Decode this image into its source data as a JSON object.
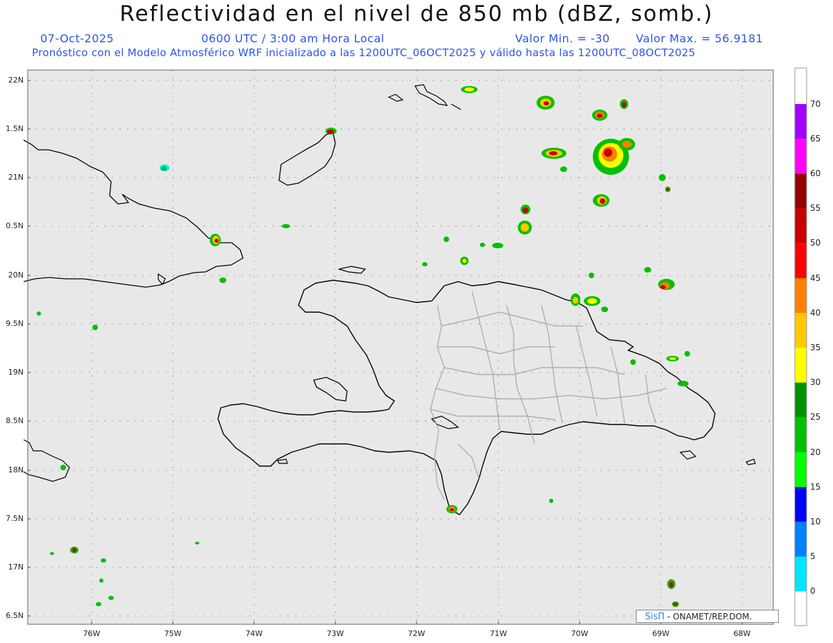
{
  "header": {
    "title": "Reflectividad en el nivel de 850 mb (dBZ, somb.)",
    "date": "07-Oct-2025",
    "time": "0600 UTC / 3:00 am Hora Local",
    "min_label": "Valor Min. = -30",
    "max_label": "Valor Max. = 56.9181",
    "forecast": "Pronóstico con el Modelo Atmosférico WRF inicializado a las 1200UTC_06OCT2025 y válido hasta las  1200UTC_08OCT2025"
  },
  "lat_labels": [
    "22N",
    "1.5N",
    "21N",
    "0.5N",
    "20N",
    "9.5N",
    "19N",
    "8.5N",
    "18N",
    "7.5N",
    "17N",
    "6.5N"
  ],
  "lon_labels": [
    "76W",
    "75W",
    "74W",
    "73W",
    "72W",
    "71W",
    "70W",
    "69W",
    "68W"
  ],
  "colorbar": {
    "labels": [
      "70",
      "65",
      "60",
      "55",
      "50",
      "45",
      "40",
      "35",
      "30",
      "25",
      "20",
      "15",
      "10",
      "5",
      "0"
    ],
    "colors": [
      "#a100ff",
      "#ff00ff",
      "#960000",
      "#c80000",
      "#ff0000",
      "#ff8000",
      "#ffc800",
      "#ffff00",
      "#009000",
      "#00c000",
      "#00ff00",
      "#0000ff",
      "#0080ff",
      "#00e6ff",
      "#ffffff"
    ]
  },
  "credit": {
    "logo": "SisΠ",
    "text": "- ONAMET/REP.DOM."
  },
  "colors": {
    "background": "#e8e8e8",
    "grid": "#999999",
    "accent": "#2a55e6"
  }
}
